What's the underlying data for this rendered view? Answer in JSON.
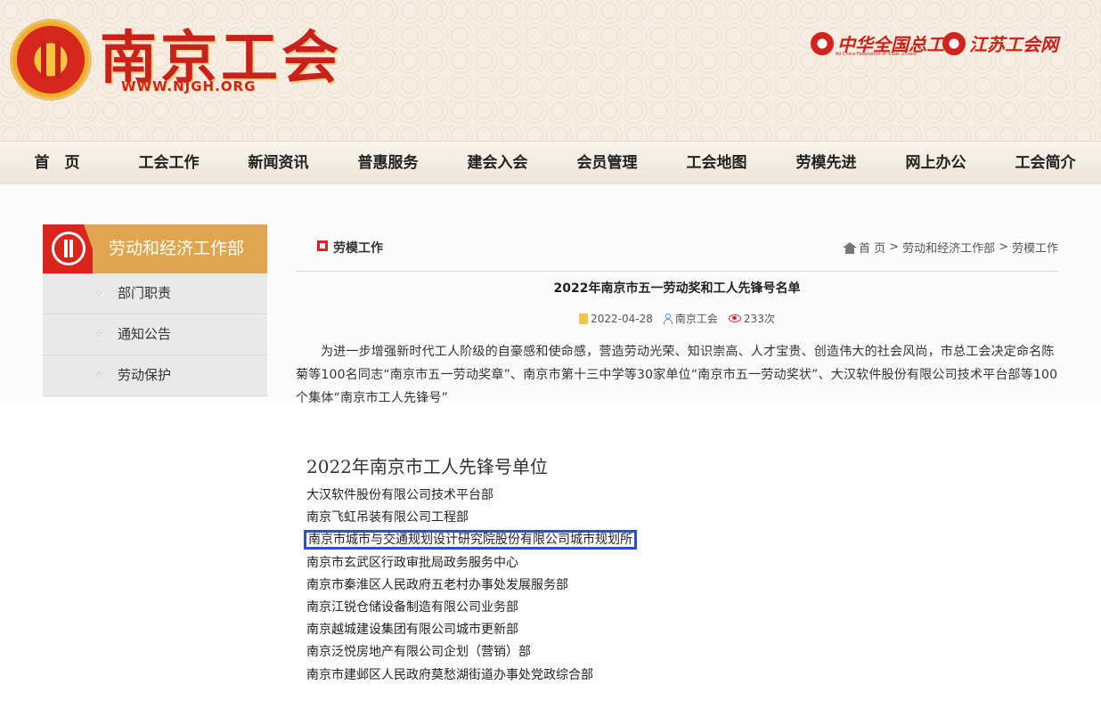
{
  "header": {
    "site_name": "南京工会",
    "site_domain": "WWW.NJGH.ORG",
    "partners": [
      {
        "name": "中华全国总工会",
        "sub": "All-China Federation of Trade Unions"
      },
      {
        "name": "江苏工会网"
      }
    ]
  },
  "nav": {
    "items": [
      "首　页",
      "工会工作",
      "新闻资讯",
      "普惠服务",
      "建会入会",
      "会员管理",
      "工会地图",
      "劳模先进",
      "网上办公",
      "工会简介"
    ]
  },
  "sidebar": {
    "title": "劳动和经济工作部",
    "items": [
      "部门职责",
      "通知公告",
      "劳动保护"
    ]
  },
  "main": {
    "section_title": "劳模工作",
    "breadcrumb": {
      "home": "首 页",
      "sep": ">",
      "level1": "劳动和经济工作部",
      "level2": "劳模工作"
    },
    "article_title": "2022年南京市五一劳动奖和工人先锋号名单",
    "date": "2022-04-28",
    "author": "南京工会",
    "views": "233次",
    "intro": "为进一步增强新时代工人阶级的自豪感和使命感，营造劳动光荣、知识崇高、人才宝贵、创造伟大的社会风尚，市总工会决定命名陈菊等100名同志“南京市五一劳动奖章”、南京市第十三中学等30家单位“南京市五一劳动奖状”、大汉软件股份有限公司技术平台部等100个集体“南京市工人先锋号”"
  },
  "list": {
    "heading": "2022年南京市工人先锋号单位",
    "items": [
      "大汉软件股份有限公司技术平台部",
      "南京飞虹吊装有限公司工程部",
      "南京市城市与交通规划设计研究院股份有限公司城市规划所",
      "南京市玄武区行政审批局政务服务中心",
      "南京市秦淮区人民政府五老村办事处发展服务部",
      "南京江锐仓储设备制造有限公司业务部",
      "南京越城建设集团有限公司城市更新部",
      "南京泛悦房地产有限公司企划（营销）部",
      "南京市建邺区人民政府莫愁湖街道办事处党政综合部"
    ],
    "highlighted_index": 2
  },
  "colors": {
    "brand_red": "#d8251e",
    "sidebar_gold": "#dfa64f",
    "highlight_blue": "#2b4ed8"
  }
}
